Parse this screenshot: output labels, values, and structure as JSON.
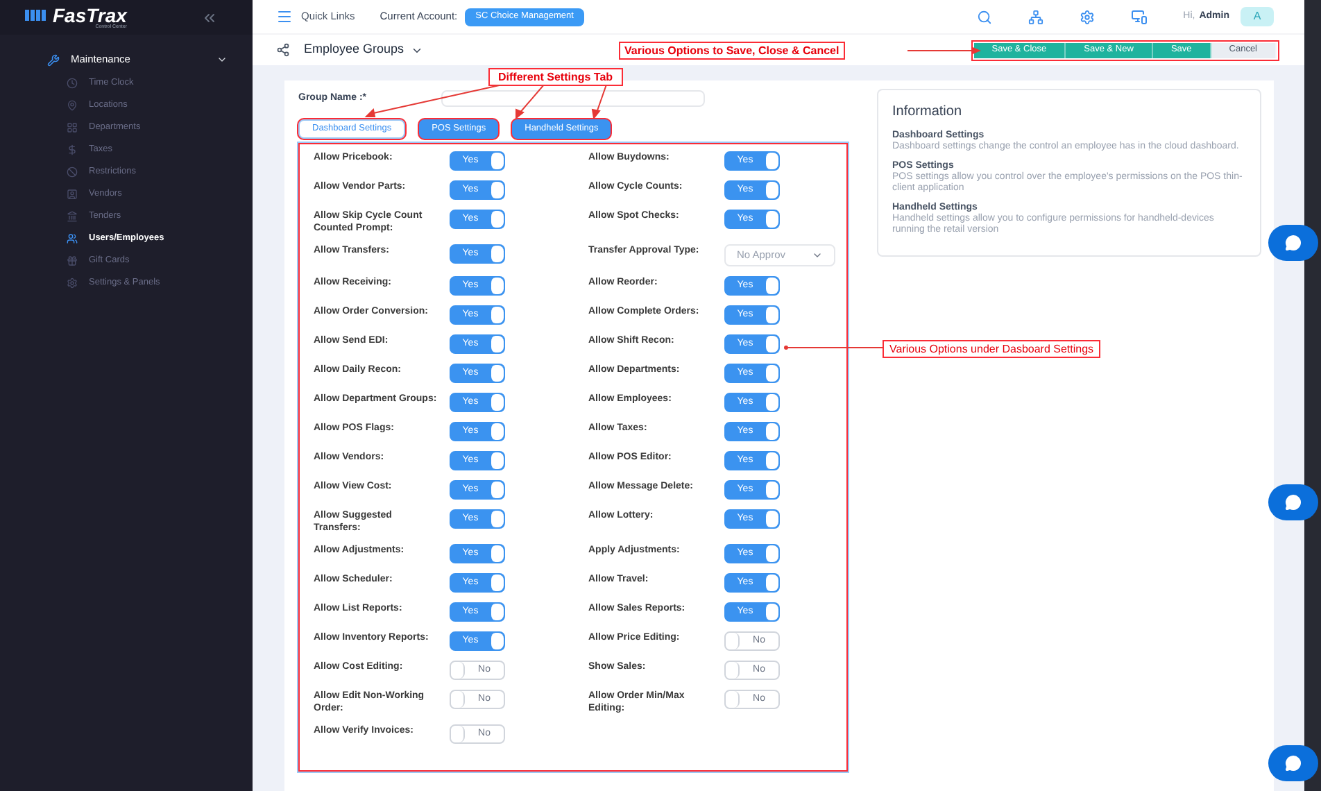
{
  "sidebar": {
    "logo": "FasTrax",
    "logo_subtitle": "Control Center",
    "section": {
      "label": "Maintenance",
      "expanded": true
    },
    "items": [
      {
        "label": "Time Clock",
        "selected": false
      },
      {
        "label": "Locations",
        "selected": false
      },
      {
        "label": "Departments",
        "selected": false
      },
      {
        "label": "Taxes",
        "selected": false
      },
      {
        "label": "Restrictions",
        "selected": false
      },
      {
        "label": "Vendors",
        "selected": false
      },
      {
        "label": "Tenders",
        "selected": false
      },
      {
        "label": "Users/Employees",
        "selected": true
      },
      {
        "label": "Gift Cards",
        "selected": false
      },
      {
        "label": "Settings & Panels",
        "selected": false
      }
    ]
  },
  "top_bar": {
    "quick_links": "Quick Links",
    "account_label": "Current Account:",
    "account": "SC Choice Management",
    "greeting": "Hi,",
    "user": "Admin",
    "avatar": "A"
  },
  "page": {
    "title": "Employee Groups",
    "buttons": [
      {
        "label": "Save & Close",
        "kind": "primary"
      },
      {
        "label": "Save & New",
        "kind": "primary"
      },
      {
        "label": "Save",
        "kind": "primary"
      },
      {
        "label": "Cancel",
        "kind": "secondary"
      }
    ]
  },
  "form": {
    "group_name_label": "Group Name :*",
    "tabs": [
      {
        "label": "Dashboard Settings",
        "selected": true
      },
      {
        "label": "POS Settings",
        "selected": false
      },
      {
        "label": "Handheld Settings",
        "selected": false
      }
    ],
    "settings": [
      {
        "label": "Allow Pricebook:",
        "kind": "toggle",
        "on": true,
        "text": "Yes"
      },
      {
        "label": "Allow Buydowns:",
        "kind": "toggle",
        "on": true,
        "text": "Yes"
      },
      {
        "label": "Allow Vendor Parts:",
        "kind": "toggle",
        "on": true,
        "text": "Yes"
      },
      {
        "label": "Allow Cycle Counts:",
        "kind": "toggle",
        "on": true,
        "text": "Yes"
      },
      {
        "label": "Allow Skip Cycle Count Counted Prompt:",
        "kind": "toggle",
        "on": true,
        "text": "Yes"
      },
      {
        "label": "Allow Spot Checks:",
        "kind": "toggle",
        "on": true,
        "text": "Yes"
      },
      {
        "label": "Allow Transfers:",
        "kind": "toggle",
        "on": true,
        "text": "Yes"
      },
      {
        "label": "Transfer Approval Type:",
        "kind": "select",
        "text": "No Approv"
      },
      {
        "label": "Allow Receiving:",
        "kind": "toggle",
        "on": true,
        "text": "Yes"
      },
      {
        "label": "Allow Reorder:",
        "kind": "toggle",
        "on": true,
        "text": "Yes"
      },
      {
        "label": "Allow Order Conversion:",
        "kind": "toggle",
        "on": true,
        "text": "Yes"
      },
      {
        "label": "Allow Complete Orders:",
        "kind": "toggle",
        "on": true,
        "text": "Yes"
      },
      {
        "label": "Allow Send EDI:",
        "kind": "toggle",
        "on": true,
        "text": "Yes"
      },
      {
        "label": "Allow Shift Recon:",
        "kind": "toggle",
        "on": true,
        "text": "Yes"
      },
      {
        "label": "Allow Daily Recon:",
        "kind": "toggle",
        "on": true,
        "text": "Yes"
      },
      {
        "label": "Allow Departments:",
        "kind": "toggle",
        "on": true,
        "text": "Yes"
      },
      {
        "label": "Allow Department Groups:",
        "kind": "toggle",
        "on": true,
        "text": "Yes"
      },
      {
        "label": "Allow Employees:",
        "kind": "toggle",
        "on": true,
        "text": "Yes"
      },
      {
        "label": "Allow POS Flags:",
        "kind": "toggle",
        "on": true,
        "text": "Yes"
      },
      {
        "label": "Allow Taxes:",
        "kind": "toggle",
        "on": true,
        "text": "Yes"
      },
      {
        "label": "Allow Vendors:",
        "kind": "toggle",
        "on": true,
        "text": "Yes"
      },
      {
        "label": "Allow POS Editor:",
        "kind": "toggle",
        "on": true,
        "text": "Yes"
      },
      {
        "label": "Allow View Cost:",
        "kind": "toggle",
        "on": true,
        "text": "Yes"
      },
      {
        "label": "Allow Message Delete:",
        "kind": "toggle",
        "on": true,
        "text": "Yes"
      },
      {
        "label": "Allow Suggested Transfers:",
        "kind": "toggle",
        "on": true,
        "text": "Yes"
      },
      {
        "label": "Allow Lottery:",
        "kind": "toggle",
        "on": true,
        "text": "Yes"
      },
      {
        "label": "Allow Adjustments:",
        "kind": "toggle",
        "on": true,
        "text": "Yes"
      },
      {
        "label": "Apply Adjustments:",
        "kind": "toggle",
        "on": true,
        "text": "Yes"
      },
      {
        "label": "Allow Scheduler:",
        "kind": "toggle",
        "on": true,
        "text": "Yes"
      },
      {
        "label": "Allow Travel:",
        "kind": "toggle",
        "on": true,
        "text": "Yes"
      },
      {
        "label": "Allow List Reports:",
        "kind": "toggle",
        "on": true,
        "text": "Yes"
      },
      {
        "label": "Allow Sales Reports:",
        "kind": "toggle",
        "on": true,
        "text": "Yes"
      },
      {
        "label": "Allow Inventory Reports:",
        "kind": "toggle",
        "on": true,
        "text": "Yes"
      },
      {
        "label": "Allow Price Editing:",
        "kind": "toggle",
        "on": false,
        "text": "No"
      },
      {
        "label": "Allow Cost Editing:",
        "kind": "toggle",
        "on": false,
        "text": "No"
      },
      {
        "label": "Show Sales:",
        "kind": "toggle",
        "on": false,
        "text": "No"
      },
      {
        "label": "Allow Edit Non-Working Order:",
        "kind": "toggle",
        "on": false,
        "text": "No"
      },
      {
        "label": "Allow Order Min/Max Editing:",
        "kind": "toggle",
        "on": false,
        "text": "No"
      },
      {
        "label": "Allow Verify Invoices:",
        "kind": "toggle",
        "on": false,
        "text": "No"
      }
    ]
  },
  "information": {
    "title": "Information",
    "sections": [
      {
        "heading": "Dashboard Settings",
        "text": "Dashboard settings change the control an employee has in the cloud dashboard."
      },
      {
        "heading": "POS Settings",
        "text": "POS settings allow you control over the employee's permissions on the POS thin-client application"
      },
      {
        "heading": "Handheld Settings",
        "text": "Handheld settings allow you to configure permissions for handheld-devices running the retail version"
      }
    ]
  },
  "annotations": [
    {
      "text": "Various Options to Save, Close & Cancel"
    },
    {
      "text": "Different Settings Tab"
    },
    {
      "text": "Various Options under Dasboard Settings"
    }
  ]
}
